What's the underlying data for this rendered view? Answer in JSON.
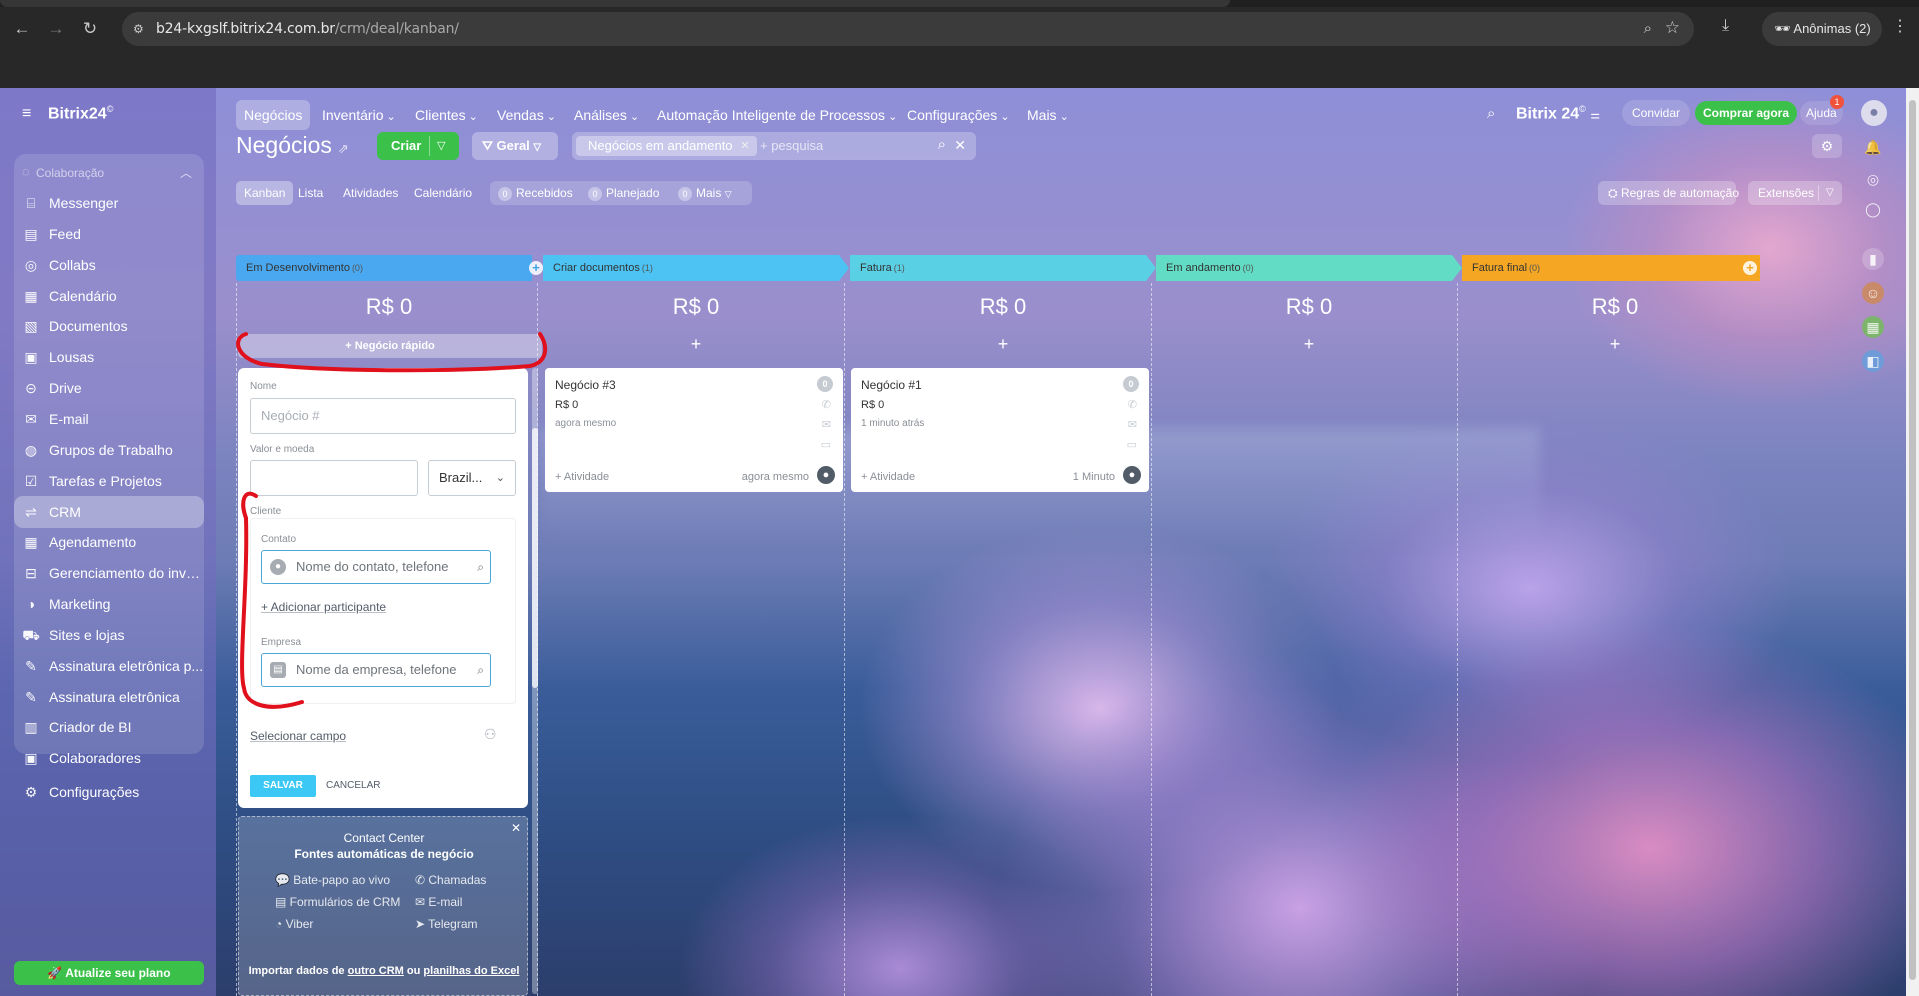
{
  "browser": {
    "url_host": "b24-kxgslf.bitrix24.com.br",
    "url_path": "/crm/deal/kanban/",
    "incognito_label": "Anônimas (2)"
  },
  "sidebar": {
    "brand": "Bitrix24",
    "brand_mark": "©",
    "group_title": "Colaboração",
    "items": [
      {
        "label": "Messenger",
        "icon": "chat-icon"
      },
      {
        "label": "Feed",
        "icon": "feed-icon"
      },
      {
        "label": "Collabs",
        "icon": "collabs-icon"
      },
      {
        "label": "Calendário",
        "icon": "calendar-icon"
      },
      {
        "label": "Documentos",
        "icon": "documents-icon"
      },
      {
        "label": "Lousas",
        "icon": "boards-icon"
      },
      {
        "label": "Drive",
        "icon": "drive-icon"
      },
      {
        "label": "E-mail",
        "icon": "mail-icon"
      },
      {
        "label": "Grupos de Trabalho",
        "icon": "groups-icon"
      },
      {
        "label": "Tarefas e Projetos",
        "icon": "tasks-icon"
      },
      {
        "label": "CRM",
        "icon": "crm-icon"
      },
      {
        "label": "Agendamento",
        "icon": "booking-icon"
      },
      {
        "label": "Gerenciamento do inve...",
        "icon": "inventory-icon"
      },
      {
        "label": "Marketing",
        "icon": "marketing-icon"
      },
      {
        "label": "Sites e lojas",
        "icon": "cart-icon"
      },
      {
        "label": "Assinatura eletrônica p...",
        "icon": "sign-icon"
      },
      {
        "label": "Assinatura eletrônica",
        "icon": "sign-icon"
      },
      {
        "label": "Criador de BI",
        "icon": "bi-icon"
      },
      {
        "label": "Colaboradores",
        "icon": "employees-icon"
      },
      {
        "label": "Configurações",
        "icon": "gear-icon"
      }
    ],
    "upgrade_label": "Atualize seu plano"
  },
  "topnav": {
    "items": [
      "Negócios",
      "Inventário",
      "Clientes",
      "Vendas",
      "Análises",
      "Automação Inteligente de Processos",
      "Configurações",
      "Mais"
    ],
    "logo": "Bitrix 24",
    "invite": "Convidar",
    "buy": "Comprar agora",
    "help": "Ajuda",
    "help_badge": "1"
  },
  "page": {
    "title": "Negócios",
    "create_label": "Criar",
    "general_label": "Geral",
    "filter_tag": "Negócios em andamento",
    "search_placeholder": "+ pesquisa",
    "views": [
      "Kanban",
      "Lista",
      "Atividades",
      "Calendário"
    ],
    "counters": [
      {
        "n": "0",
        "label": "Recebidos"
      },
      {
        "n": "0",
        "label": "Planejado"
      },
      {
        "n": "0",
        "label": "Mais"
      }
    ],
    "automation_rules": "Regras de automação",
    "extensions": "Extensões"
  },
  "columns": [
    {
      "name": "Em Desenvolvimento",
      "count": "(0)",
      "sum": "R$ 0",
      "color": "#4aa8f0"
    },
    {
      "name": "Criar documentos",
      "count": "(1)",
      "sum": "R$ 0",
      "color": "#4cc3f2"
    },
    {
      "name": "Fatura",
      "count": "(1)",
      "sum": "R$ 0",
      "color": "#5ad0e4"
    },
    {
      "name": "Em andamento",
      "count": "(0)",
      "sum": "R$ 0",
      "color": "#62dcc4"
    },
    {
      "name": "Fatura final",
      "count": "(0)",
      "sum": "R$ 0",
      "color": "#f5a623"
    }
  ],
  "quick_deal": {
    "button": "+ Negócio rápido",
    "name_label": "Nome",
    "name_placeholder": "Negócio #",
    "value_label": "Valor e moeda",
    "currency": "Brazil...",
    "client_label": "Cliente",
    "contact_label": "Contato",
    "contact_placeholder": "Nome do contato, telefone",
    "add_participant": "+ Adicionar participante",
    "company_label": "Empresa",
    "company_placeholder": "Nome da empresa, telefone",
    "select_field": "Selecionar campo",
    "save": "SALVAR",
    "cancel": "CANCELAR"
  },
  "contact_center": {
    "title": "Contact Center",
    "subtitle": "Fontes automáticas de negócio",
    "items": [
      "Bate-papo ao vivo",
      "Chamadas",
      "Formulários de CRM",
      "E-mail",
      "Viber",
      "Telegram"
    ],
    "footer_prefix": "Importar dados de",
    "footer_link1": "outro CRM",
    "footer_mid": "ou",
    "footer_link2": "planilhas do Excel"
  },
  "cards": [
    {
      "title": "Negócio #3",
      "amount": "R$ 0",
      "time": "agora mesmo",
      "activity": "+ Atividade",
      "right_time": "agora mesmo",
      "badge": "0"
    },
    {
      "title": "Negócio #1",
      "amount": "R$ 0",
      "time": "1 minuto atrás",
      "activity": "+ Atividade",
      "right_time": "1 Minuto",
      "badge": "0"
    }
  ]
}
